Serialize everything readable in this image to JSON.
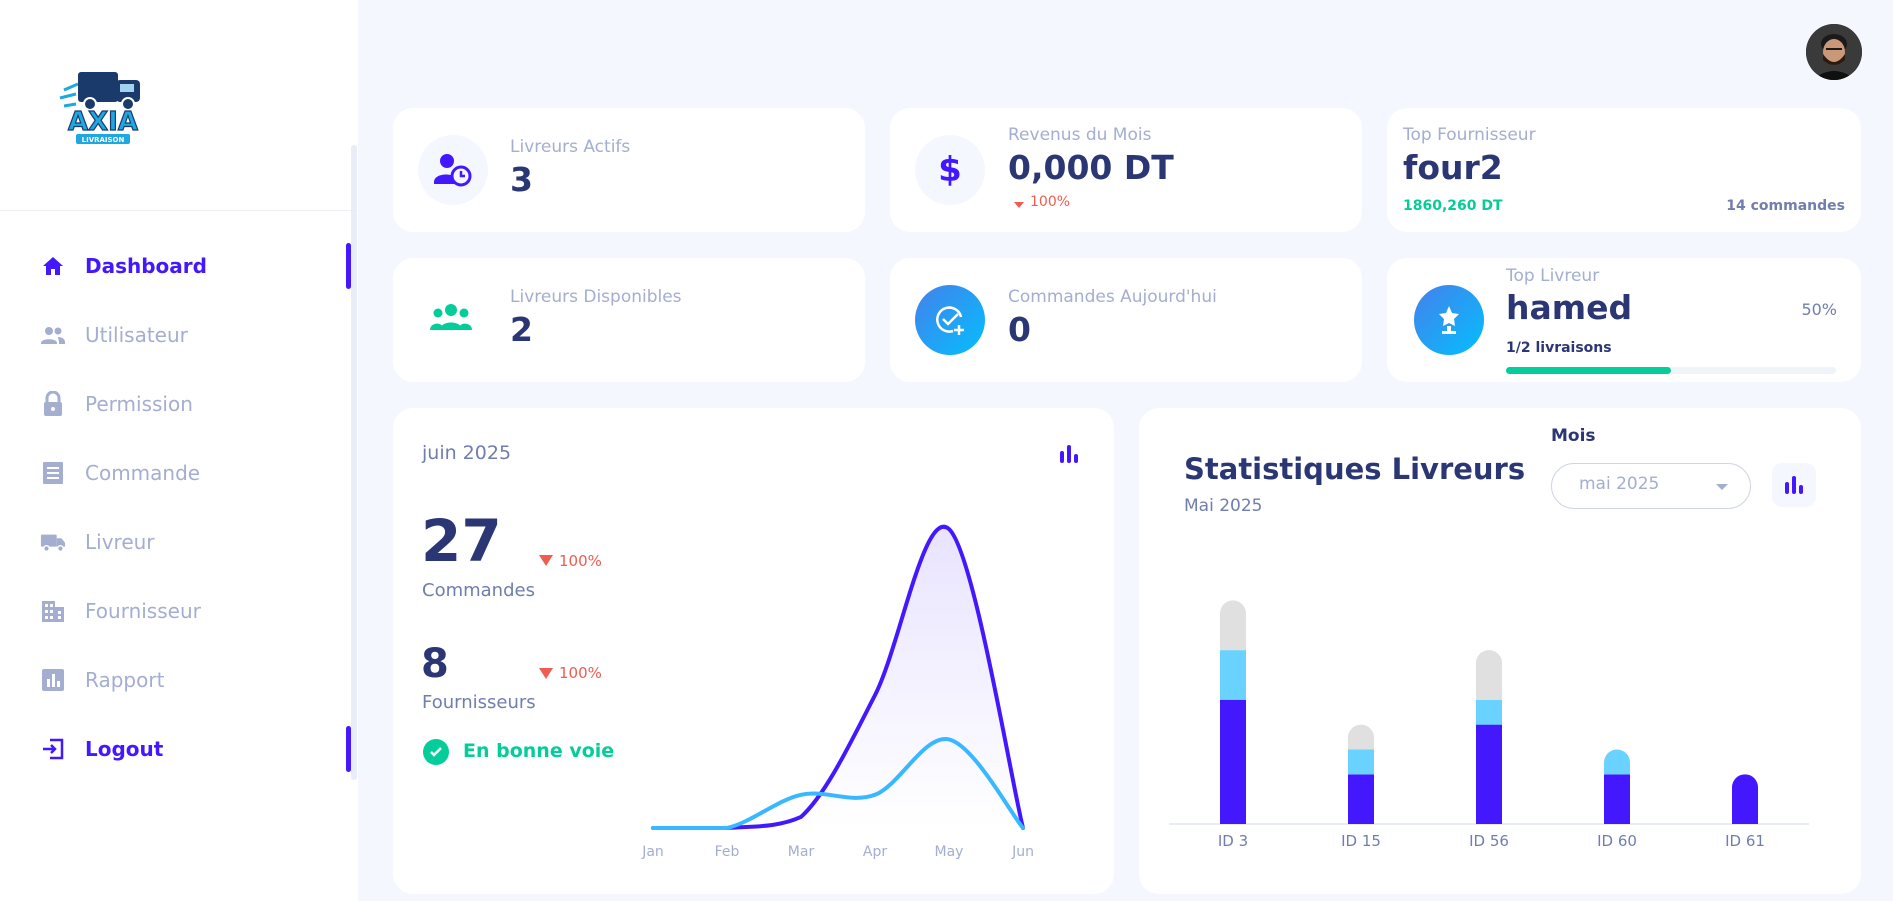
{
  "brand": {
    "logo_text": "AXIA",
    "logo_subtext": "LIVRAISON"
  },
  "sidebar": {
    "items": [
      {
        "label": "Dashboard",
        "icon": "home-icon",
        "active": true
      },
      {
        "label": "Utilisateur",
        "icon": "users-icon",
        "active": false
      },
      {
        "label": "Permission",
        "icon": "lock-icon",
        "active": false
      },
      {
        "label": "Commande",
        "icon": "receipt-icon",
        "active": false
      },
      {
        "label": "Livreur",
        "icon": "truck-icon",
        "active": false
      },
      {
        "label": "Fournisseur",
        "icon": "building-icon",
        "active": false
      },
      {
        "label": "Rapport",
        "icon": "report-icon",
        "active": false
      },
      {
        "label": "Logout",
        "icon": "logout-icon",
        "active": true
      }
    ]
  },
  "stats": {
    "livreurs_actifs": {
      "label": "Livreurs Actifs",
      "value": "3"
    },
    "revenus": {
      "label": "Revenus du Mois",
      "value": "0,000 DT",
      "change": "100%"
    },
    "top_fournisseur": {
      "label": "Top Fournisseur",
      "value": "four2",
      "amount": "1860,260 DT",
      "orders": "14 commandes"
    },
    "livreurs_dispo": {
      "label": "Livreurs Disponibles",
      "value": "2"
    },
    "commandes_jour": {
      "label": "Commandes Aujourd'hui",
      "value": "0"
    },
    "top_livreur": {
      "label": "Top Livreur",
      "value": "hamed",
      "percent": "50%",
      "deliveries": "1/2 livraisons",
      "progress": 0.5
    }
  },
  "monthly": {
    "period": "juin 2025",
    "commandes": {
      "value": "27",
      "label": "Commandes",
      "change": "100%"
    },
    "fournisseurs": {
      "value": "8",
      "label": "Fournisseurs",
      "change": "100%"
    },
    "status": "En bonne voie"
  },
  "livreurs_panel": {
    "title": "Statistiques Livreurs",
    "subtitle": "Mai 2025",
    "select_label": "Mois",
    "select_value": "mai 2025"
  },
  "colors": {
    "accent": "#4318ff",
    "cyan": "#39b8ff",
    "light_cyan": "#6ad2ff",
    "grey": "#e0e0e0",
    "green": "#05cd99",
    "red": "#ee5d50"
  },
  "chart_data": [
    {
      "type": "area",
      "categories": [
        "Jan",
        "Feb",
        "Mar",
        "Apr",
        "May",
        "Jun"
      ],
      "series": [
        {
          "values": [
            0,
            0,
            1,
            12,
            27,
            0
          ],
          "color": "#4318ff"
        },
        {
          "values": [
            0,
            0,
            3,
            3,
            8,
            0
          ],
          "color": "#39b8ff"
        }
      ],
      "ylim": [
        0,
        28
      ],
      "grid": false
    },
    {
      "type": "bar",
      "stacked": true,
      "categories": [
        "ID 3",
        "ID 15",
        "ID 56",
        "ID 60",
        "ID 61"
      ],
      "series": [
        {
          "values": [
            5,
            2,
            4,
            2,
            2
          ],
          "color": "#4318ff"
        },
        {
          "values": [
            2,
            1,
            1,
            1,
            0
          ],
          "color": "#6ad2ff"
        },
        {
          "values": [
            2,
            1,
            2,
            0,
            0
          ],
          "color": "#e0e0e0"
        }
      ],
      "ylim": [
        0,
        9.5
      ],
      "grid": false
    }
  ]
}
